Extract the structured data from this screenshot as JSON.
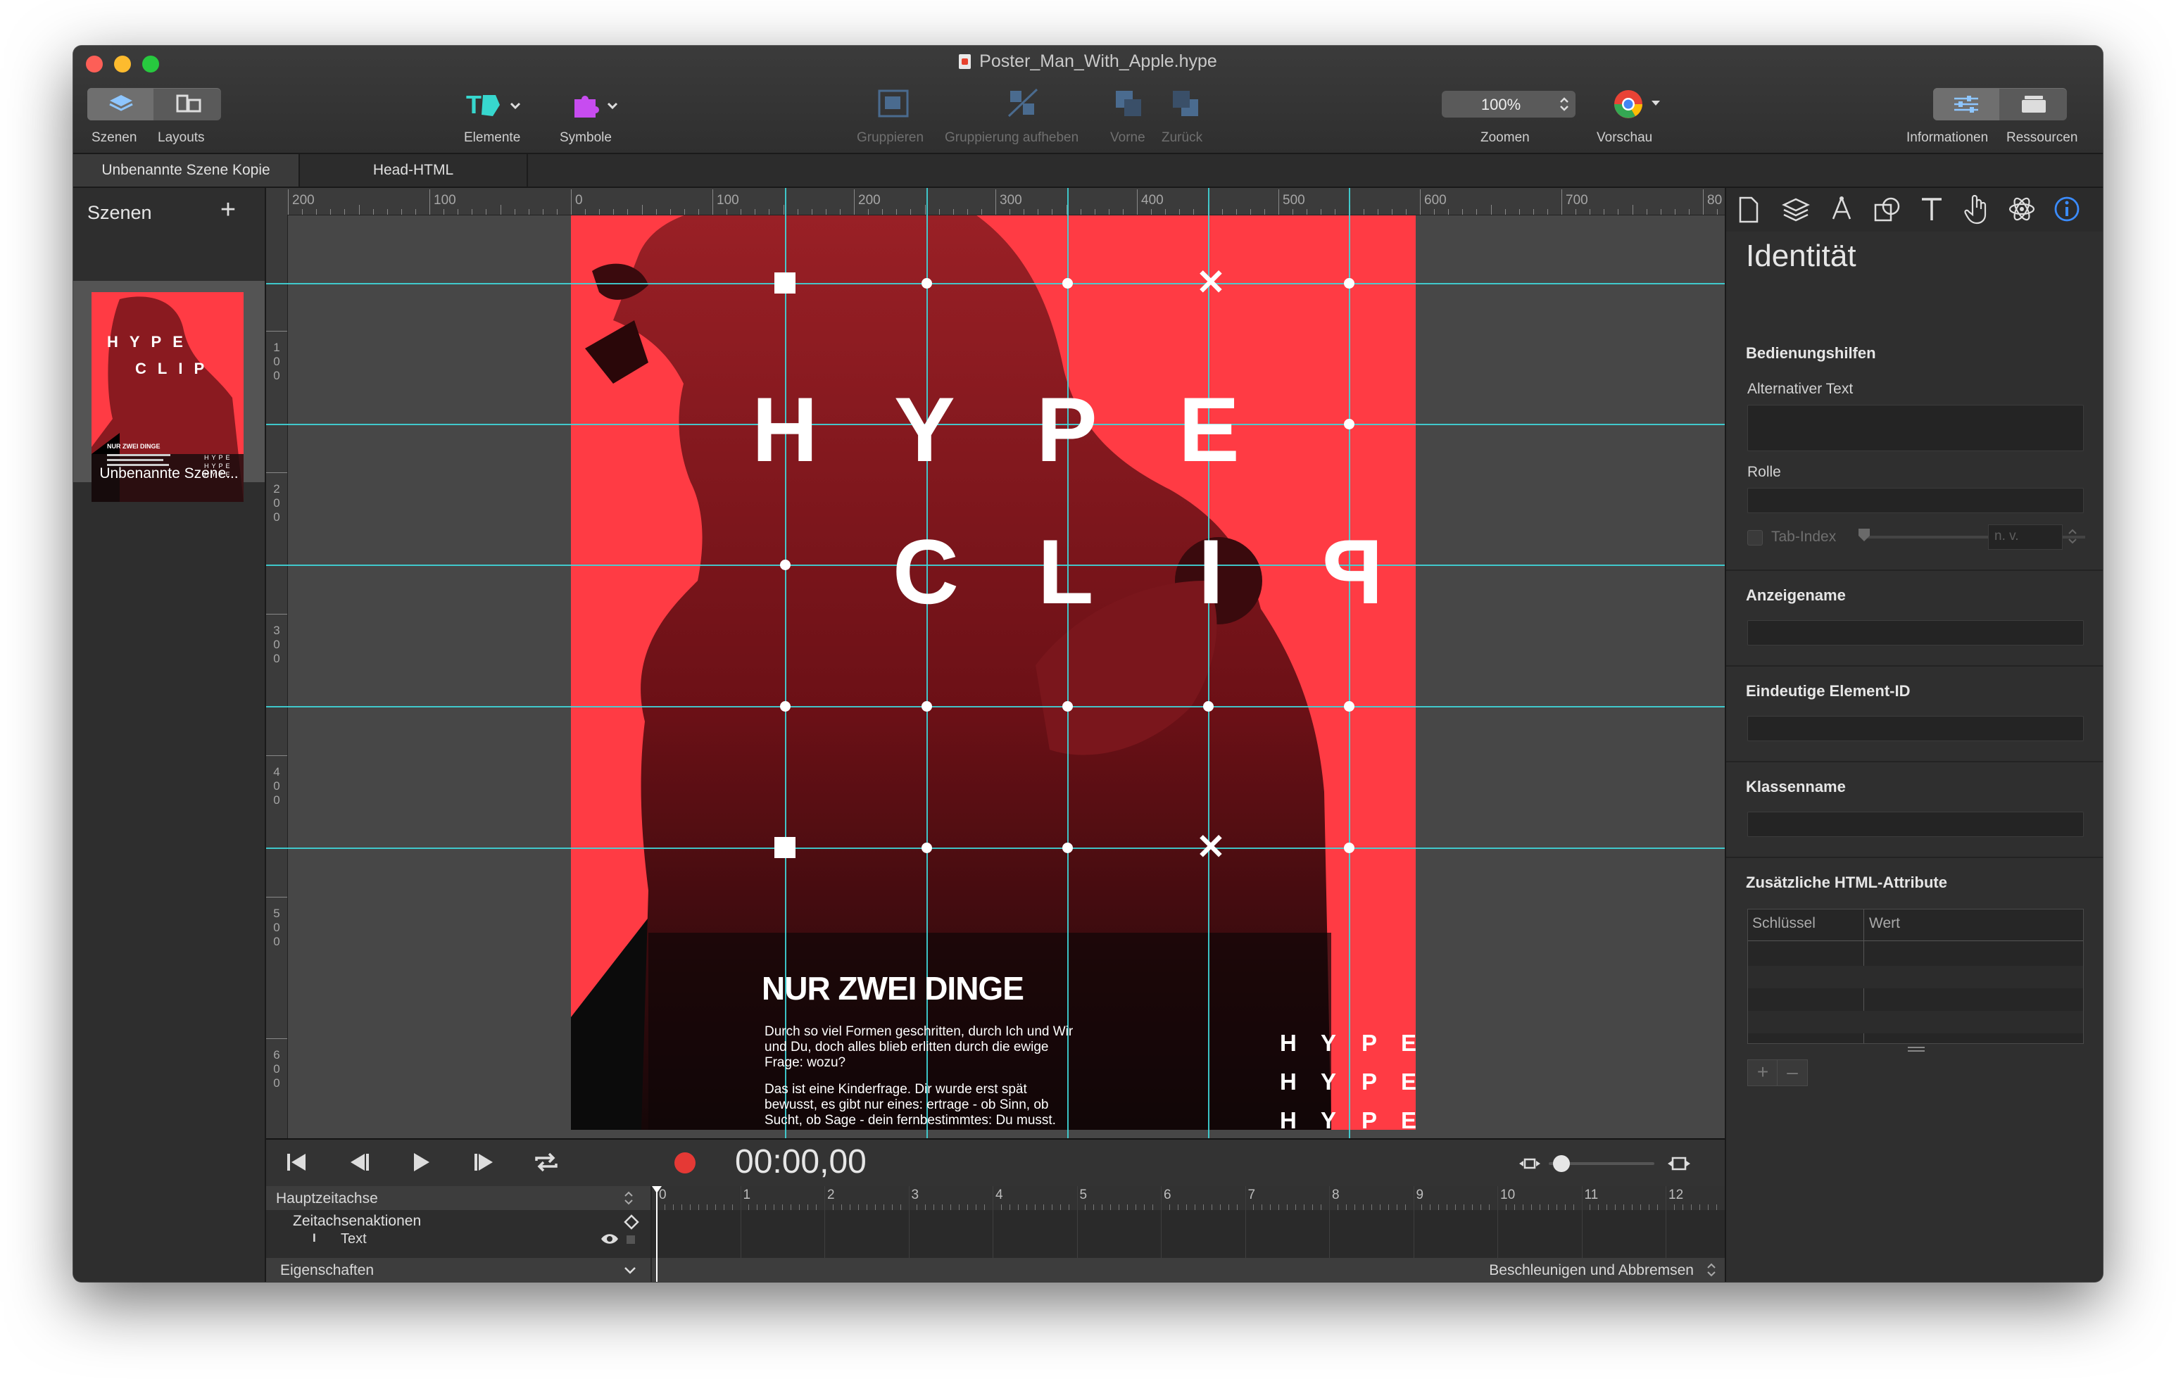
{
  "window": {
    "title": "Poster_Man_With_Apple.hype"
  },
  "toolbar": {
    "scenes_label": "Szenen",
    "layouts_label": "Layouts",
    "elements_label": "Elemente",
    "symbols_label": "Symbole",
    "group_label": "Gruppieren",
    "ungroup_label": "Gruppierung aufheben",
    "front_label": "Vorne",
    "back_label": "Zurück",
    "zoom_value": "100%",
    "zoom_label": "Zoomen",
    "preview_label": "Vorschau",
    "info_label": "Informationen",
    "resources_label": "Ressourcen"
  },
  "tabs": [
    {
      "label": "Unbenannte Szene Kopie"
    },
    {
      "label": "Head-HTML"
    }
  ],
  "scenes": {
    "title": "Szenen",
    "add": "+",
    "items": [
      {
        "label": "Unbenannte Szene..."
      }
    ]
  },
  "rulers": {
    "h_ticks": [
      "200",
      "100",
      "0",
      "100",
      "200",
      "300",
      "400",
      "500",
      "600",
      "700",
      "80"
    ],
    "v_ticks": [
      "100",
      "200",
      "300",
      "400",
      "500",
      "600"
    ]
  },
  "poster": {
    "row1": [
      "H",
      "Y",
      "P",
      "E"
    ],
    "row2": [
      "C",
      "L",
      "I",
      "P"
    ],
    "headline": "NUR ZWEI DINGE",
    "para1": "Durch so viel Formen geschritten, durch Ich und Wir und Du, doch alles blieb erlitten durch die ewige Frage: wozu?",
    "para2": "Das ist eine Kinderfrage. Dir wurde erst spät bewusst, es gibt nur eines: ertrage - ob Sinn, ob Sucht, ob Sage - dein fernbestimmtes: Du musst.",
    "hype_rows": [
      [
        "H",
        "Y",
        "P",
        "E"
      ],
      [
        "H",
        "Y",
        "P",
        "E"
      ],
      [
        "H",
        "Y",
        "P",
        "E"
      ]
    ],
    "colors": {
      "background": "#ff3b44",
      "photo": "#8a1a20"
    }
  },
  "timeline": {
    "time": "00:00,00",
    "main_timeline": "Hauptzeitachse",
    "actions": "Zeitachsenaktionen",
    "layer": "Text",
    "layer_icon": "I",
    "properties": "Eigenschaften",
    "easing": "Beschleunigen und Abbremsen",
    "ticks": [
      "0",
      "1",
      "2",
      "3",
      "4",
      "5",
      "6",
      "7",
      "8",
      "9",
      "10",
      "11",
      "12"
    ]
  },
  "inspector": {
    "title": "Identität",
    "accessibility": "Bedienungshilfen",
    "alt_text": "Alternativer Text",
    "role": "Rolle",
    "tab_index": "Tab-Index",
    "tab_index_value": "n. v.",
    "display_name": "Anzeigename",
    "element_id": "Eindeutige Element-ID",
    "class_name": "Klassenname",
    "html_attributes": "Zusätzliche HTML-Attribute",
    "key_col": "Schlüssel",
    "value_col": "Wert",
    "add": "+",
    "remove": "–",
    "icons": [
      "document-icon",
      "layers-icon",
      "pen-icon",
      "shapes-icon",
      "text-icon",
      "hand-icon",
      "atom-icon",
      "info-icon"
    ]
  },
  "accent": "#3fd7da"
}
